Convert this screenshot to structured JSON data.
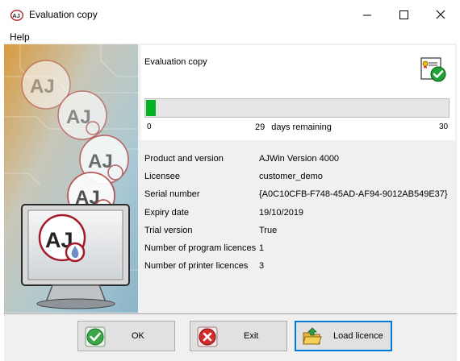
{
  "window": {
    "title": "Evaluation copy",
    "app_icon": "aj-logo-icon",
    "controls": [
      "minimize-icon",
      "maximize-icon",
      "close-icon"
    ]
  },
  "menu": {
    "items": [
      {
        "label": "Help"
      }
    ]
  },
  "header": {
    "title": "Evaluation copy",
    "icon": "certificate-check-icon"
  },
  "progress": {
    "min": "0",
    "max": "30",
    "remaining": "29",
    "remaining_suffix": "days remaining",
    "fill_fraction": 0.033,
    "fill_color": "#06b025"
  },
  "info": [
    {
      "label": "Product and version",
      "value": "AJWin   Version 4000"
    },
    {
      "label": "Licensee",
      "value": "customer_demo"
    },
    {
      "label": "Serial number",
      "value": "{A0C10CFB-F748-45AD-AF94-9012AB549E37}"
    },
    {
      "label": "Expiry date",
      "value": "19/10/2019"
    },
    {
      "label": "Trial version",
      "value": "True"
    },
    {
      "label": "Number of program licences",
      "value": "1"
    },
    {
      "label": "Number of printer licences",
      "value": "3"
    }
  ],
  "buttons": {
    "ok": {
      "label": "OK",
      "icon": "checkmark-icon"
    },
    "exit": {
      "label": "Exit",
      "icon": "stop-x-icon"
    },
    "load": {
      "label": "Load licence",
      "icon": "folder-open-icon"
    }
  }
}
